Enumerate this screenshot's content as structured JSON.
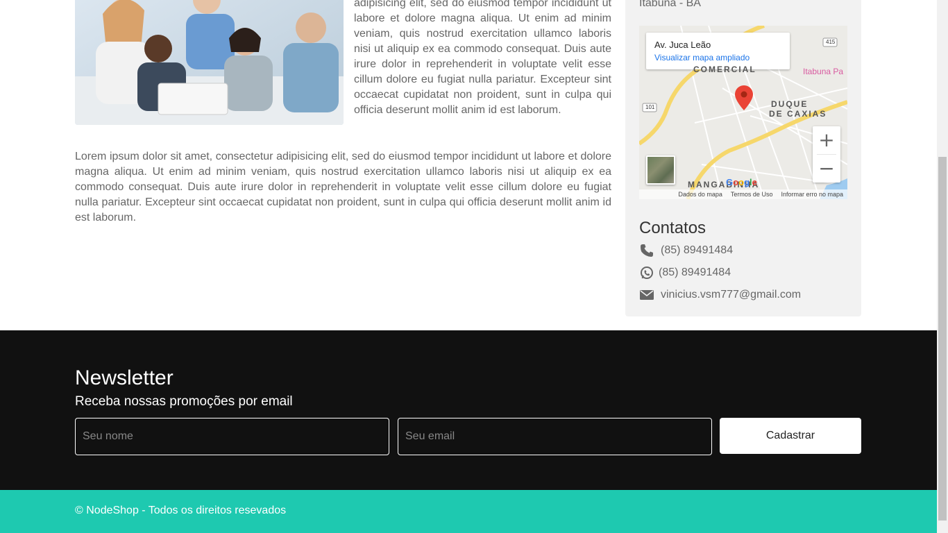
{
  "article": {
    "side_text": "adipisicing elit, sed do eiusmod tempor incididunt ut labore et dolore magna aliqua. Ut enim ad minim veniam, quis nostrud exercitation ullamco laboris nisi ut aliquip ex ea commodo consequat. Duis aute irure dolor in reprehenderit in voluptate velit esse cillum dolore eu fugiat nulla pariatur. Excepteur sint occaecat cupidatat non proident, sunt in culpa qui officia deserunt mollit anim id est laborum.",
    "full_text": "Lorem ipsum dolor sit amet, consectetur adipisicing elit, sed do eiusmod tempor incididunt ut labore et dolore magna aliqua. Ut enim ad minim veniam, quis nostrud exercitation ullamco laboris nisi ut aliquip ex ea commodo consequat. Duis aute irure dolor in reprehenderit in voluptate velit esse cillum dolore eu fugiat nulla pariatur. Excepteur sint occaecat cupidatat non proident, sunt in culpa qui officia deserunt mollit anim id est laborum."
  },
  "sidebar": {
    "city": "Itabuna - BA",
    "map": {
      "place_title": "Av. Juca Leão",
      "view_larger": "Visualizar mapa ampliado",
      "label_comercial": "COMERCIAL",
      "label_duque": "DUQUE",
      "label_caxias": "DE CAXIAS",
      "label_mangabinha": "MANGABINHA",
      "label_itabuna": "Itabuna Pa",
      "road_101": "101",
      "road_415": "415",
      "zoom_in": "+",
      "zoom_out": "−",
      "google": "Google",
      "footer_map_data": "Dados do mapa",
      "footer_terms": "Termos de Uso",
      "footer_report": "Informar erro no mapa"
    },
    "contacts_title": "Contatos",
    "contacts": [
      {
        "icon": "phone-icon",
        "text": "(85) 89491484"
      },
      {
        "icon": "whatsapp-icon",
        "text": "(85) 89491484"
      },
      {
        "icon": "envelope-icon",
        "text": "vinicius.vsm777@gmail.com"
      }
    ]
  },
  "newsletter": {
    "title": "Newsletter",
    "subtitle": "Receba nossas promoções por email",
    "name_placeholder": "Seu nome",
    "email_placeholder": "Seu email",
    "submit_label": "Cadastrar"
  },
  "footer": {
    "copyright": "© NodeShop - Todos os direitos resevados"
  },
  "colors": {
    "footer_bg": "#1ec9b0",
    "newsletter_bg": "#111111",
    "sidebar_bg": "#f2f2f2",
    "map_pin": "#ea4335",
    "map_link": "#1a73e8"
  }
}
